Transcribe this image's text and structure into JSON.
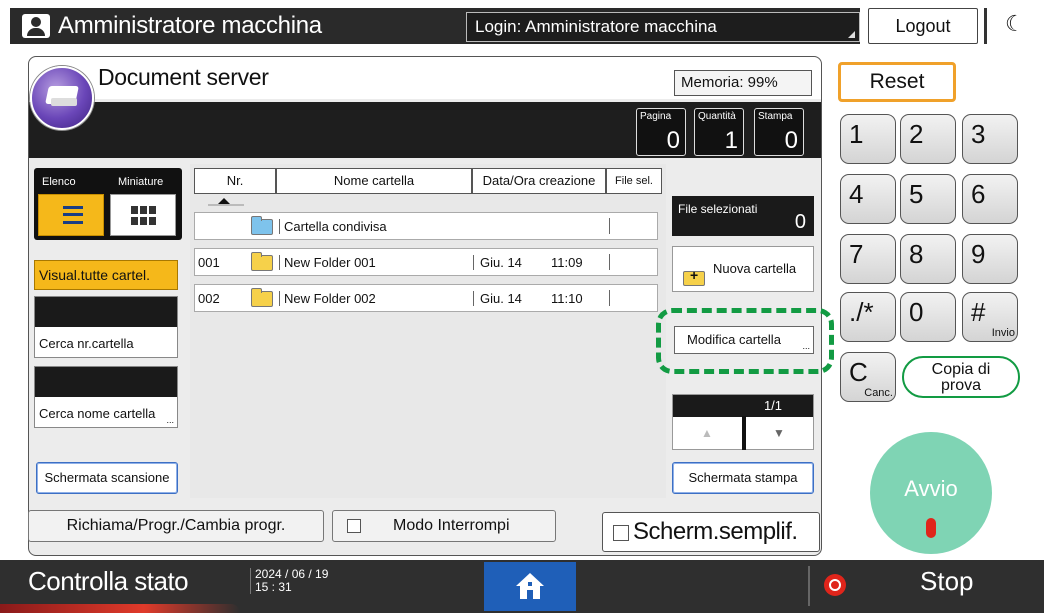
{
  "topbar": {
    "user_title": "Amministratore macchina",
    "login_text": "Login: Amministratore macchina",
    "logout_label": "Logout"
  },
  "app": {
    "title": "Document server",
    "memory": "Memoria:  99%"
  },
  "counters": [
    {
      "label": "Pagina",
      "value": "0"
    },
    {
      "label": "Quantità",
      "value": "1"
    },
    {
      "label": "Stampa",
      "value": "0"
    }
  ],
  "view": {
    "elenco_label": "Elenco",
    "miniature_label": "Miniature"
  },
  "left": {
    "visual_all": "Visual.tutte cartel.",
    "search_nr": "Cerca nr.cartella",
    "search_name": "Cerca nome cartella",
    "scan_screen": "Schermata scansione"
  },
  "table": {
    "headers": {
      "nr": "Nr.",
      "name": "Nome cartella",
      "date": "Data/Ora creazione",
      "file_sel": "File sel."
    },
    "shared_folder": "Cartella condivisa",
    "rows": [
      {
        "nr": "001",
        "name": "New Folder 001",
        "date": "Giu. 14",
        "time": "11:09"
      },
      {
        "nr": "002",
        "name": "New Folder 002",
        "date": "Giu. 14",
        "time": "11:10"
      }
    ]
  },
  "right": {
    "selected_files_label": "File selezionati",
    "selected_files_value": "0",
    "new_folder": "Nuova cartella",
    "edit_folder": "Modifica cartella",
    "page_indicator": "1/1",
    "print_screen": "Schermata stampa"
  },
  "bottom_buttons": {
    "recall": "Richiama/Progr./Cambia progr.",
    "interrupt": "Modo Interrompi",
    "simplified": "Scherm.semplif."
  },
  "keypad": {
    "reset": "Reset",
    "keys": [
      "1",
      "2",
      "3",
      "4",
      "5",
      "6",
      "7",
      "8",
      "9",
      "./*",
      "0",
      "#"
    ],
    "enter_sub": "Invio",
    "clear": "C",
    "clear_sub": "Canc.",
    "proof_copy_line1": "Copia di",
    "proof_copy_line2": "prova",
    "start": "Avvio"
  },
  "statusbar": {
    "check_status": "Controlla stato",
    "date": "2024 / 06 / 19",
    "time": "15 : 31",
    "stop": "Stop"
  },
  "colors": {
    "accent_yellow": "#f5b81a",
    "highlight_green": "#129b43",
    "start_green": "#7fd4b4",
    "home_blue": "#1f5fb8",
    "stop_red": "#e0251b"
  }
}
